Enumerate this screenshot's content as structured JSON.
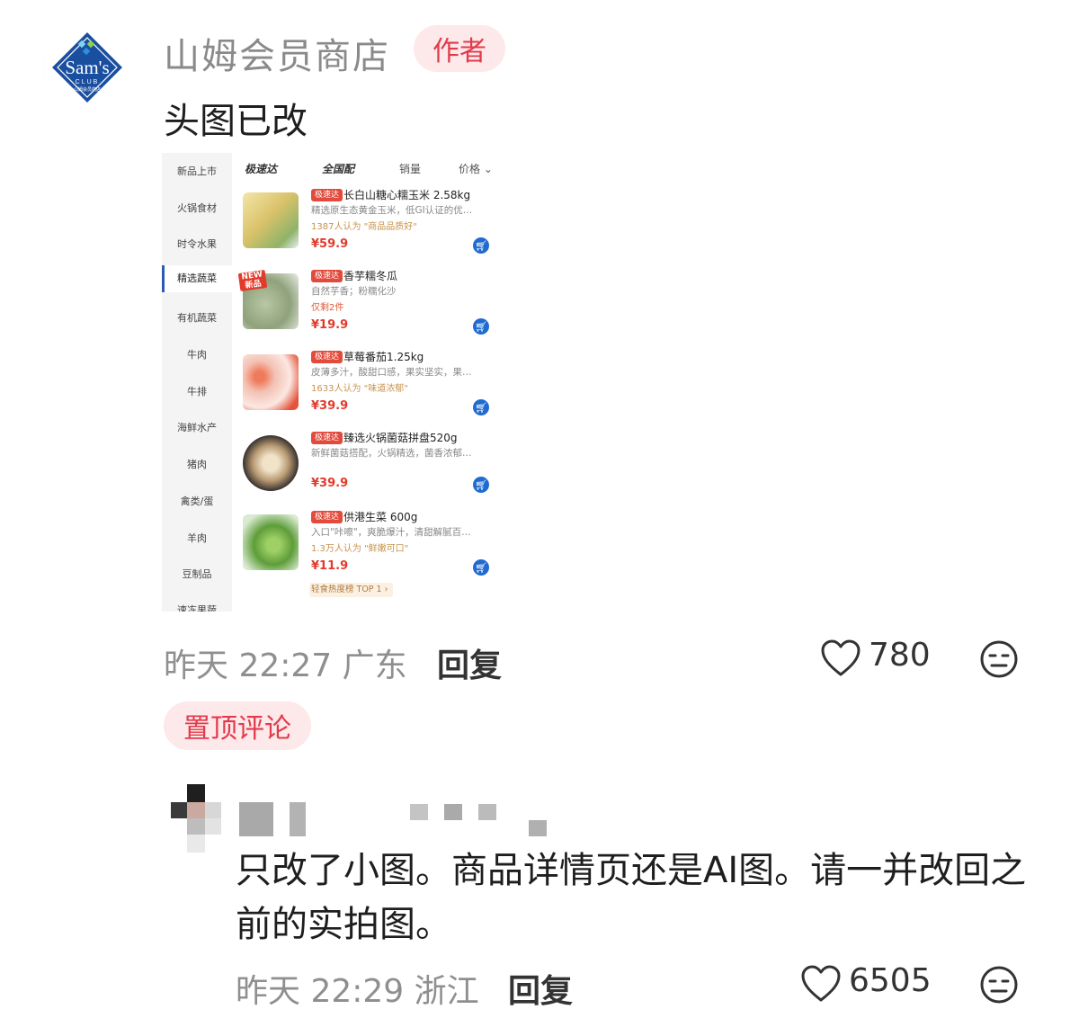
{
  "author_comment": {
    "avatar": {
      "brand": "Sam's",
      "sub1": "CLUB",
      "sub2": "山姆会员商店"
    },
    "username": "山姆会员商店",
    "author_tag": "作者",
    "text": "头图已改",
    "time_location": "昨天 22:27 广东",
    "reply_label": "回复",
    "likes": "780"
  },
  "embedded_screenshot": {
    "categories": [
      "新品上市",
      "火锅食材",
      "时令水果",
      "精选蔬菜",
      "有机蔬菜",
      "牛肉",
      "牛排",
      "海鲜水产",
      "猪肉",
      "禽类/蛋",
      "羊肉",
      "豆制品",
      "速冻果蔬"
    ],
    "active_category": "精选蔬菜",
    "tabs": [
      "极速达",
      "全国配",
      "销量",
      "价格 ⌄"
    ],
    "products": [
      {
        "badge": "极速达",
        "title": "长白山糖心糯玉米  2.58kg",
        "desc": "精选原生态黄金玉米，低GI认证的优…",
        "note": "1387人认为 \"商品品质好\"",
        "price": "¥59.9"
      },
      {
        "badge": "极速达",
        "title": "香芋糯冬瓜",
        "desc": "自然芋香；粉糯化沙",
        "note": "仅剩2件",
        "price": "¥19.9",
        "new_badge": "NEW 新品"
      },
      {
        "badge": "极速达",
        "title": "草莓番茄1.25kg",
        "desc": "皮薄多汁，酸甜口感，果实坚实，果…",
        "note": "1633人认为 \"味道浓郁\"",
        "price": "¥39.9"
      },
      {
        "badge": "极速达",
        "title": "臻选火锅菌菇拼盘520g",
        "desc": "新鲜菌菇搭配，火锅精选，菌香浓郁…",
        "note": "",
        "price": "¥39.9"
      },
      {
        "badge": "极速达",
        "title": "供港生菜 600g",
        "desc": "入口\"咔嚓\"，爽脆爆汁，清甜解腻百…",
        "note": "1.3万人认为 \"鲜嫩可口\"",
        "price": "¥11.9"
      }
    ],
    "rank_label": "轻食热度榜 TOP 1 ›"
  },
  "pinned_tag": "置顶评论",
  "reply_comment": {
    "text": "只改了小图。商品详情页还是AI图。请一并改回之前的实拍图。",
    "time_location": "昨天 22:29 浙江",
    "reply_label": "回复",
    "likes": "6505"
  },
  "icons": {
    "heart": "heart-outline-icon",
    "emoji": "expressionless-face-icon",
    "cart": "cart-icon"
  },
  "colors": {
    "tag_bg": "#fde8ea",
    "tag_text": "#e23a4b",
    "price_red": "#e23a2b",
    "cart_blue": "#1f6bd1",
    "sams_blue": "#1a4fa0"
  }
}
